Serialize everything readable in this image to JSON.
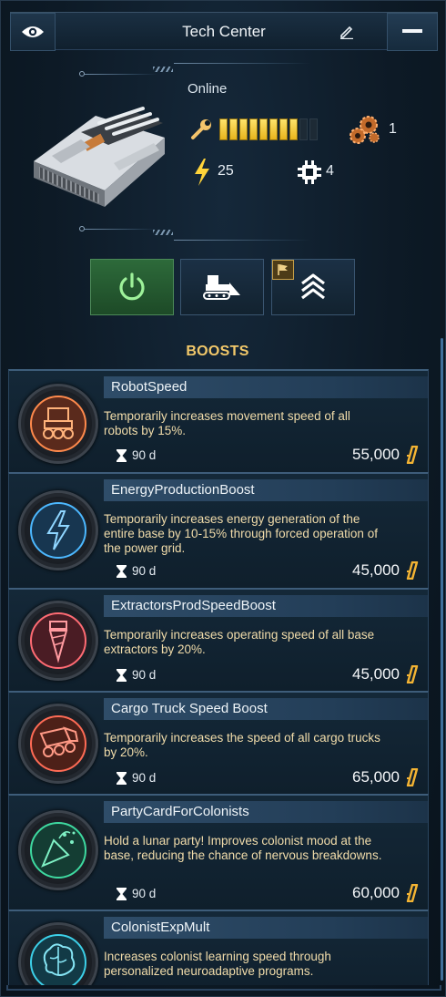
{
  "header": {
    "title": "Tech Center",
    "eye_icon": "eye-icon",
    "edit_icon": "pencil-icon",
    "minimize_icon": "minimize-icon"
  },
  "building": {
    "status": "Online",
    "condition_segments_total": 10,
    "condition_segments_filled": 8,
    "gears_count": "1",
    "energy": "25",
    "chips": "4"
  },
  "actions": {
    "power_icon": "power-icon",
    "demolish_icon": "bulldozer-icon",
    "upgrade_icon": "chevrons-up-icon",
    "flag_icon": "flag-icon"
  },
  "boosts": {
    "title": "BOOSTS",
    "items": [
      {
        "name": "RobotSpeed",
        "description": "Temporarily increases movement speed of all robots by 15%.",
        "duration": "90 d",
        "price": "55,000",
        "icon": "robot-rover-icon",
        "color": "#ff8a4c"
      },
      {
        "name": "EnergyProductionBoost",
        "description": "Temporarily increases energy generation of the entire base by 10-15% through forced operation of the power grid.",
        "duration": "90 d",
        "price": "45,000",
        "icon": "lightning-icon",
        "color": "#4cb8ff"
      },
      {
        "name": "ExtractorsProdSpeedBoost",
        "description": "Temporarily increases operating speed of all base extractors by 20%.",
        "duration": "90 d",
        "price": "45,000",
        "icon": "drill-icon",
        "color": "#ff6b73"
      },
      {
        "name": "Cargo Truck Speed Boost",
        "description": "Temporarily increases the speed of all cargo trucks by 20%.",
        "duration": "90 d",
        "price": "65,000",
        "icon": "truck-icon",
        "color": "#ff6b55"
      },
      {
        "name": "PartyCardForColonists",
        "description": "Hold a lunar party! Improves colonist mood at the base, reducing the chance of nervous breakdowns.",
        "duration": "90 d",
        "price": "60,000",
        "icon": "party-popper-icon",
        "color": "#3ed9a0"
      },
      {
        "name": "ColonistExpMult",
        "description": "Increases colonist learning speed through personalized neuroadaptive programs.",
        "duration": "",
        "price": "",
        "icon": "brain-icon",
        "color": "#3cd0e8"
      }
    ]
  }
}
